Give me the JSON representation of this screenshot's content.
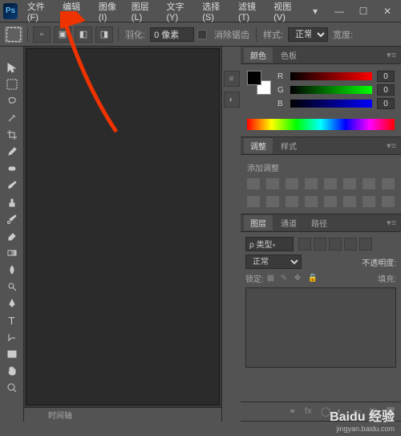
{
  "logo_text": "Ps",
  "menu": {
    "file": "文件(F)",
    "edit": "编辑(E)",
    "image": "图像(I)",
    "layer": "图层(L)",
    "type": "文字(Y)",
    "select": "选择(S)",
    "filter": "滤镜(T)",
    "view": "视图(V)"
  },
  "win_controls": {
    "chevron": "▾",
    "min": "—",
    "max": "☐",
    "close": "✕"
  },
  "options": {
    "feather_label": "羽化:",
    "feather_value": "0 像素",
    "antialias_label": "消除锯齿",
    "style_label": "样式:",
    "style_value": "正常",
    "width_label": "宽度:"
  },
  "panels": {
    "color_tab": "颜色",
    "swatch_tab": "色板",
    "r_label": "R",
    "g_label": "G",
    "b_label": "B",
    "r_val": "0",
    "g_val": "0",
    "b_val": "0",
    "adjust_tab": "调整",
    "styles_tab": "样式",
    "add_adjust": "添加调整",
    "layers_tab": "图层",
    "channels_tab": "通道",
    "paths_tab": "路径",
    "kind_label": "ρ 类型",
    "blend_value": "正常",
    "opacity_label": "不透明度:",
    "lock_label": "锁定:",
    "fill_label": "填充:"
  },
  "bottom_tab": "时间轴",
  "watermark": {
    "brand": "Baidu 经验",
    "url": "jingyan.baidu.com"
  }
}
